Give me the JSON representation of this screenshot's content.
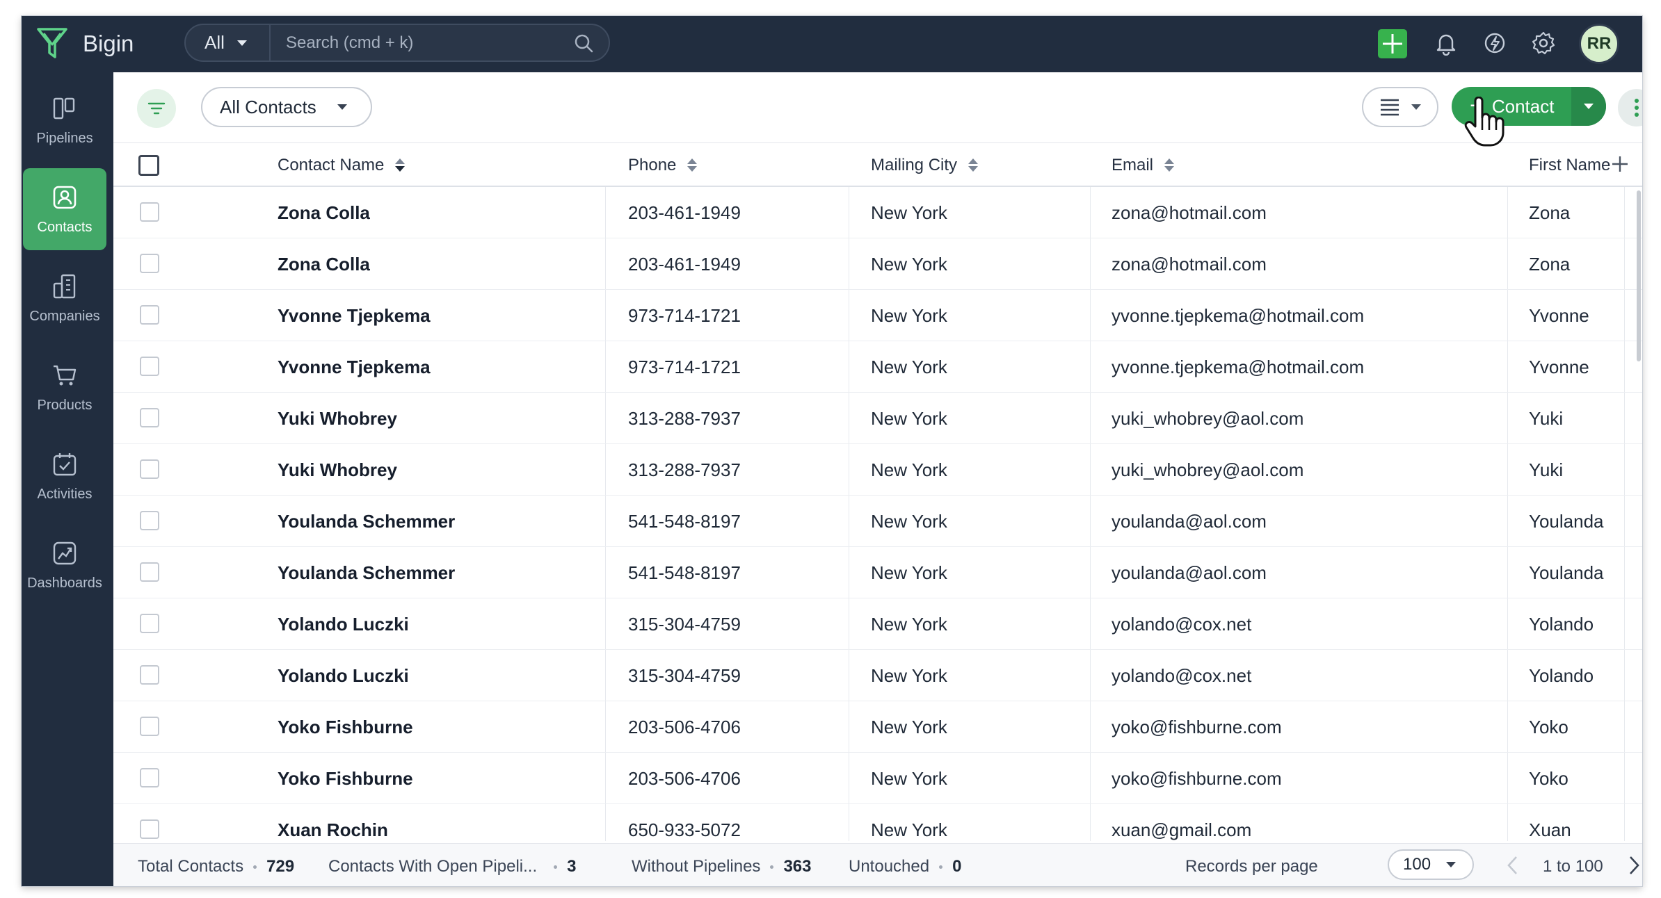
{
  "app": {
    "name": "Bigin"
  },
  "colors": {
    "topbar": "#212d3f",
    "accent": "#2e9e53",
    "active_nav": "#43a868"
  },
  "search": {
    "scope": "All",
    "placeholder": "Search (cmd + k)"
  },
  "topbar": {
    "icons": [
      "plus-icon",
      "bell-icon",
      "zia-icon",
      "gear-icon"
    ],
    "avatar_initials": "RR"
  },
  "sidebar": {
    "items": [
      {
        "label": "Pipelines",
        "icon": "pipelines-icon",
        "active": false
      },
      {
        "label": "Contacts",
        "icon": "contacts-icon",
        "active": true
      },
      {
        "label": "Companies",
        "icon": "companies-icon",
        "active": false
      },
      {
        "label": "Products",
        "icon": "products-icon",
        "active": false
      },
      {
        "label": "Activities",
        "icon": "activities-icon",
        "active": false
      },
      {
        "label": "Dashboards",
        "icon": "dashboards-icon",
        "active": false
      }
    ]
  },
  "toolbar": {
    "view": "All Contacts",
    "add_label": "Contact"
  },
  "table": {
    "columns": [
      "Contact Name",
      "Phone",
      "Mailing City",
      "Email",
      "First Name"
    ],
    "rows": [
      [
        "Zona Colla",
        "203-461-1949",
        "New York",
        "zona@hotmail.com",
        "Zona"
      ],
      [
        "Zona Colla",
        "203-461-1949",
        "New York",
        "zona@hotmail.com",
        "Zona"
      ],
      [
        "Yvonne Tjepkema",
        "973-714-1721",
        "New York",
        "yvonne.tjepkema@hotmail.com",
        "Yvonne"
      ],
      [
        "Yvonne Tjepkema",
        "973-714-1721",
        "New York",
        "yvonne.tjepkema@hotmail.com",
        "Yvonne"
      ],
      [
        "Yuki Whobrey",
        "313-288-7937",
        "New York",
        "yuki_whobrey@aol.com",
        "Yuki"
      ],
      [
        "Yuki Whobrey",
        "313-288-7937",
        "New York",
        "yuki_whobrey@aol.com",
        "Yuki"
      ],
      [
        "Youlanda Schemmer",
        "541-548-8197",
        "New York",
        "youlanda@aol.com",
        "Youlanda"
      ],
      [
        "Youlanda Schemmer",
        "541-548-8197",
        "New York",
        "youlanda@aol.com",
        "Youlanda"
      ],
      [
        "Yolando Luczki",
        "315-304-4759",
        "New York",
        "yolando@cox.net",
        "Yolando"
      ],
      [
        "Yolando Luczki",
        "315-304-4759",
        "New York",
        "yolando@cox.net",
        "Yolando"
      ],
      [
        "Yoko Fishburne",
        "203-506-4706",
        "New York",
        "yoko@fishburne.com",
        "Yoko"
      ],
      [
        "Yoko Fishburne",
        "203-506-4706",
        "New York",
        "yoko@fishburne.com",
        "Yoko"
      ],
      [
        "Xuan Rochin",
        "650-933-5072",
        "New York",
        "xuan@gmail.com",
        "Xuan"
      ]
    ]
  },
  "footer": {
    "stats": [
      {
        "label": "Total Contacts",
        "value": "729"
      },
      {
        "label": "Contacts With Open Pipeli...",
        "value": "3"
      },
      {
        "label": "Without Pipelines",
        "value": "363"
      },
      {
        "label": "Untouched",
        "value": "0"
      }
    ],
    "records_per_page_label": "Records per page",
    "records_per_page": "100",
    "range": "1 to 100"
  }
}
